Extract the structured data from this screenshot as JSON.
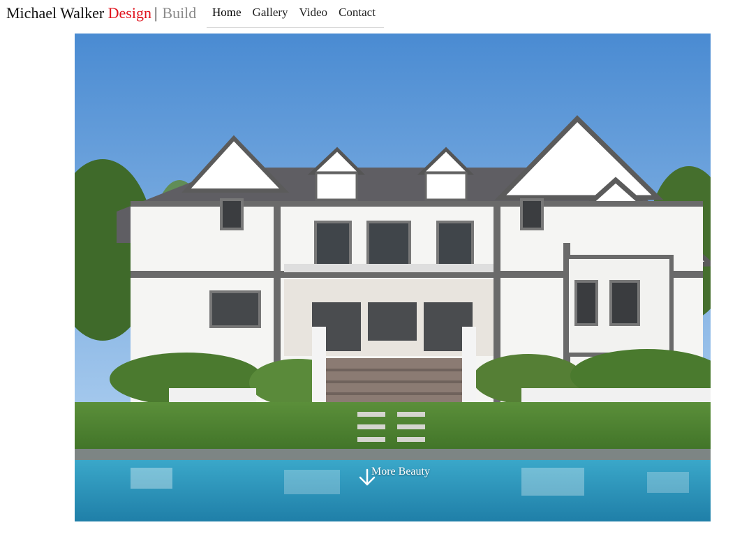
{
  "header": {
    "brand": {
      "name": "Michael Walker",
      "design": "Design",
      "separator": "|",
      "build": "Build"
    },
    "nav": [
      {
        "label": "Home"
      },
      {
        "label": "Gallery"
      },
      {
        "label": "Video"
      },
      {
        "label": "Contact"
      }
    ]
  },
  "hero": {
    "cta_label": "More Beauty",
    "cta_icon": "arrow-down-icon"
  },
  "colors": {
    "brand_accent": "#e0141e",
    "brand_muted": "#8a8a8a",
    "nav_border": "#d8d8d8"
  }
}
